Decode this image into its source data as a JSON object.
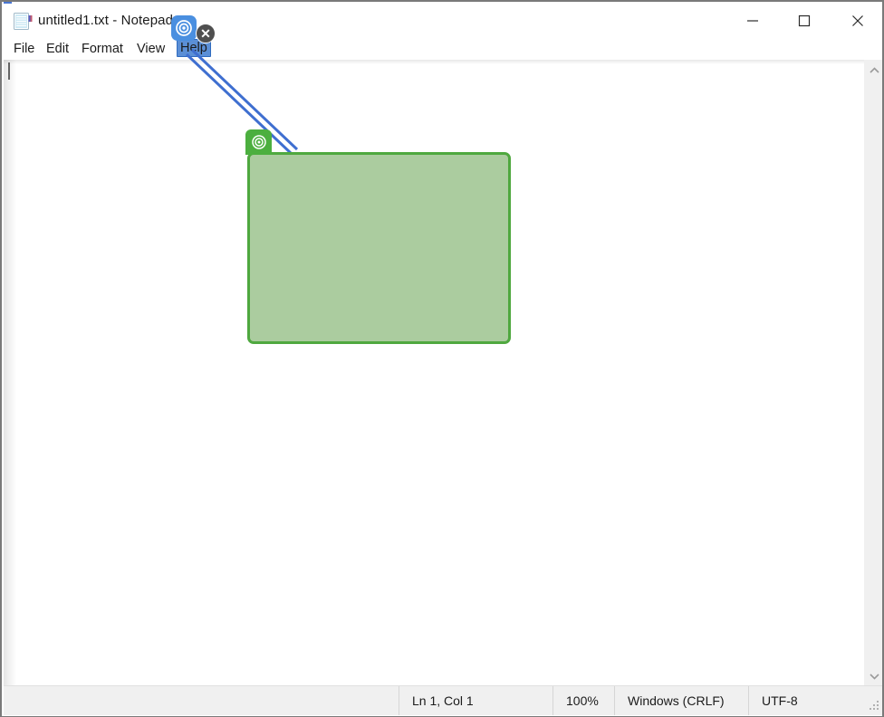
{
  "window": {
    "title": "untitled1.txt - Notepad",
    "icon": "notepad-icon",
    "controls": {
      "minimize": "–",
      "maximize": "□",
      "close": "✕"
    }
  },
  "menu": {
    "items": [
      {
        "label": "File",
        "selected": false
      },
      {
        "label": "Edit",
        "selected": false
      },
      {
        "label": "Format",
        "selected": false
      },
      {
        "label": "View",
        "selected": false
      },
      {
        "label": "Help",
        "selected": true
      }
    ]
  },
  "editor": {
    "content": "",
    "caret_visible": true
  },
  "scrollbar": {
    "up_arrow": "⌃",
    "down_arrow": "⌄"
  },
  "status_bar": {
    "line_col": "Ln 1, Col 1",
    "zoom": "100%",
    "line_ending": "Windows (CRLF)",
    "encoding": "UTF-8"
  },
  "annotation": {
    "source_marker": {
      "icon": "target-icon",
      "color": "#4a8fe0",
      "attached_to": "Help"
    },
    "close_button": {
      "icon": "close-icon",
      "glyph": "✕"
    },
    "region_marker": {
      "icon": "target-icon",
      "color": "#4caf3f"
    },
    "region_box": {
      "fill": "#abcc9f",
      "border": "#4fa83f"
    },
    "connector": {
      "color": "#3f6fd0",
      "style": "double-line"
    }
  }
}
